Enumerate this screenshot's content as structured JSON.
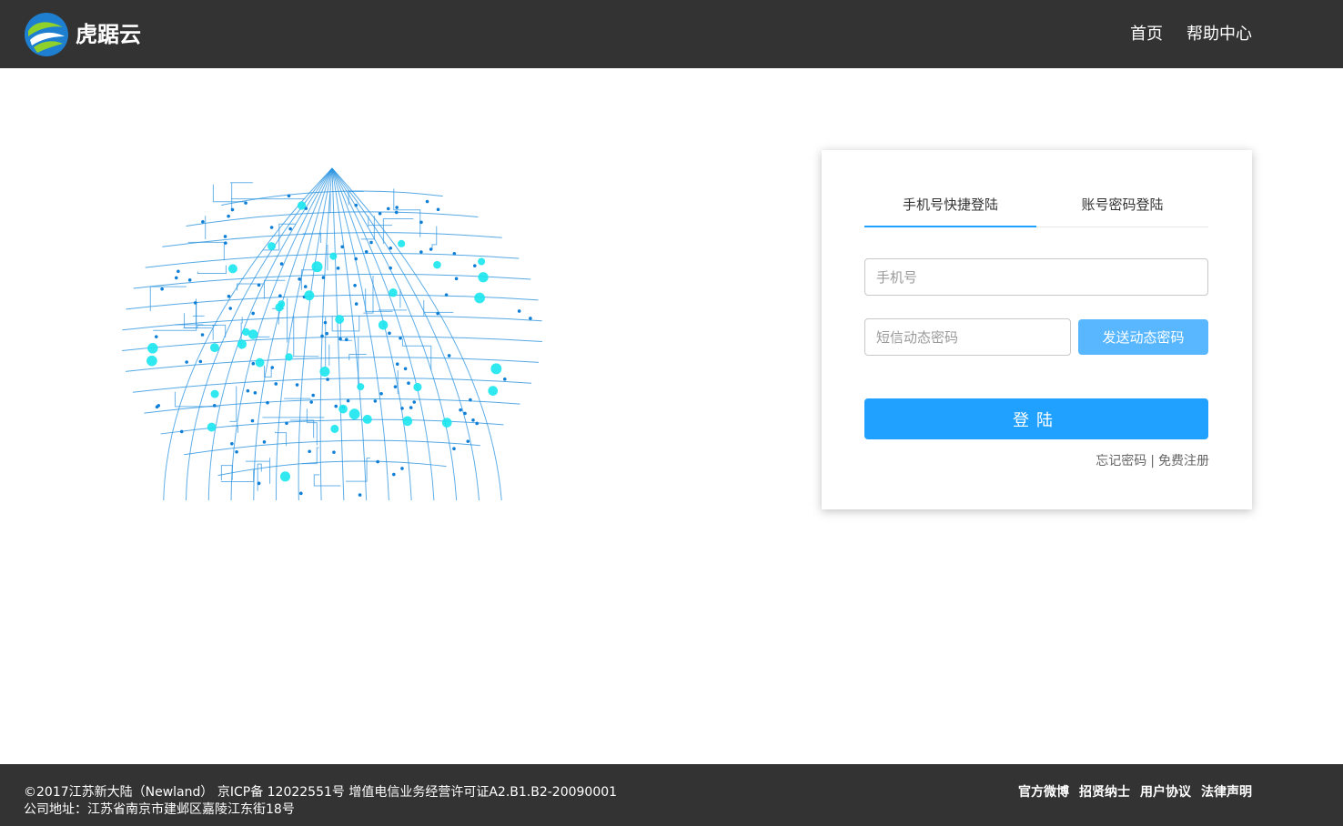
{
  "header": {
    "brand": "虎踞云",
    "logo_icon": "china-mobile-swirl-logo",
    "nav": [
      {
        "label": "首页"
      },
      {
        "label": "帮助中心"
      }
    ]
  },
  "illustration": {
    "icon": "digital-globe-circuit-icon",
    "colors": {
      "line": "#2a93df",
      "node": "#0f7fd6",
      "highlight": "#19e6ee"
    }
  },
  "login": {
    "tabs": [
      {
        "label": "手机号快捷登陆",
        "active": true
      },
      {
        "label": "账号密码登陆",
        "active": false
      }
    ],
    "phone_placeholder": "手机号",
    "sms_placeholder": "短信动态密码",
    "send_code_label": "发送动态密码",
    "submit_label": "登陆",
    "forgot_label": "忘记密码",
    "separator": "|",
    "register_label": "免费注册"
  },
  "footer": {
    "copyright": "©2017江苏新大陆（Newland） 京ICP备 12022551号 增值电信业务经营许可证A2.B1.B2-20090001",
    "address": "公司地址：江苏省南京市建邺区嘉陵江东街18号",
    "links": [
      {
        "label": "官方微博"
      },
      {
        "label": "招贤纳士"
      },
      {
        "label": "用户协议"
      },
      {
        "label": "法律声明"
      }
    ]
  },
  "colors": {
    "header_bg": "#333333",
    "accent": "#20a0ff",
    "accent_light": "#58b7ff",
    "footer_bg": "#333333"
  }
}
